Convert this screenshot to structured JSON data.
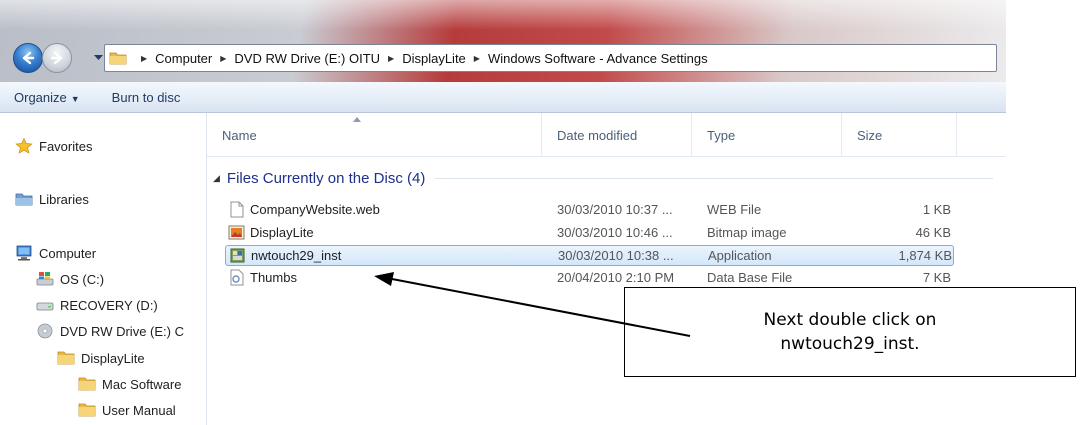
{
  "address": {
    "crumbs": [
      "Computer",
      "DVD RW Drive (E:) OITU",
      "DisplayLite",
      "Windows Software - Advance Settings"
    ]
  },
  "toolbar": {
    "organize_label": "Organize",
    "burn_label": "Burn to disc"
  },
  "nav": {
    "favorites": "Favorites",
    "libraries": "Libraries",
    "computer": "Computer",
    "os_c": "OS (C:)",
    "recovery_d": "RECOVERY (D:)",
    "dvd_e": "DVD RW Drive (E:) C",
    "displaylite": "DisplayLite",
    "mac_software": "Mac Software",
    "user_manual": "User Manual"
  },
  "columns": {
    "name": "Name",
    "date": "Date modified",
    "type": "Type",
    "size": "Size"
  },
  "group": {
    "label": "Files Currently on the Disc (4)"
  },
  "files": [
    {
      "name": "CompanyWebsite.web",
      "date": "30/03/2010 10:37 ...",
      "type": "WEB File",
      "size": "1 KB"
    },
    {
      "name": "DisplayLite",
      "date": "30/03/2010 10:46 ...",
      "type": "Bitmap image",
      "size": "46 KB"
    },
    {
      "name": "nwtouch29_inst",
      "date": "30/03/2010 10:38 ...",
      "type": "Application",
      "size": "1,874 KB"
    },
    {
      "name": "Thumbs",
      "date": "20/04/2010 2:10 PM",
      "type": "Data Base File",
      "size": "7 KB"
    }
  ],
  "callout": {
    "line1": "Next double click on",
    "line2": "nwtouch29_inst."
  },
  "colors": {
    "group_text": "#1e3287",
    "selection_border": "#84acdd",
    "column_text": "#4c607a"
  }
}
